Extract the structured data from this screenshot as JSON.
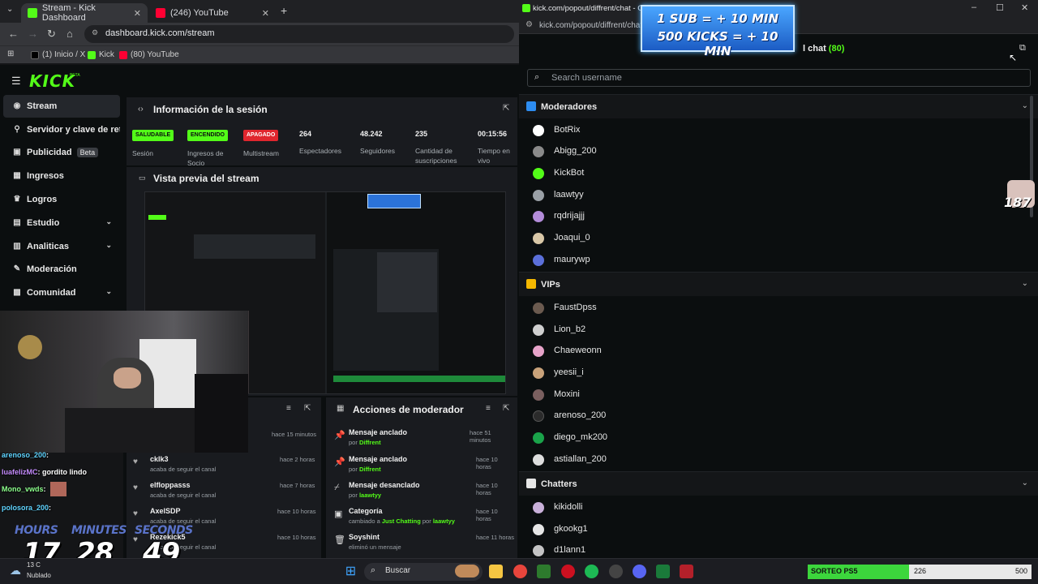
{
  "left_browser": {
    "tabs": [
      {
        "label": "Stream - Kick Dashboard",
        "icon": "kick-icon",
        "active": true
      },
      {
        "label": "(246) YouTube",
        "icon": "youtube-icon",
        "active": false
      }
    ],
    "new_tab": "+",
    "url": "dashboard.kick.com/stream",
    "bookmarks": [
      {
        "label": "(1) Inicio / X",
        "icon": "x-icon"
      },
      {
        "label": "Kick",
        "icon": "kick-icon"
      },
      {
        "label": "(80) YouTube",
        "icon": "youtube-icon"
      }
    ]
  },
  "kick": {
    "logo": "KICK",
    "logo_beta": "BETA",
    "sidebar": [
      {
        "label": "Stream",
        "icon": "stream-icon",
        "active": true,
        "chevron": false
      },
      {
        "label": "Servidor y clave de retransmisión",
        "icon": "server-icon",
        "active": false,
        "chevron": false
      },
      {
        "label": "Publicidad",
        "icon": "ads-icon",
        "active": false,
        "chevron": false,
        "badge": "Beta"
      },
      {
        "label": "Ingresos",
        "icon": "income-icon",
        "active": false,
        "chevron": false
      },
      {
        "label": "Logros",
        "icon": "trophy-icon",
        "active": false,
        "chevron": false
      },
      {
        "label": "Estudio",
        "icon": "studio-icon",
        "active": false,
        "chevron": true
      },
      {
        "label": "Analiticas",
        "icon": "analytics-icon",
        "active": false,
        "chevron": true
      },
      {
        "label": "Moderación",
        "icon": "moderation-icon",
        "active": false,
        "chevron": false
      },
      {
        "label": "Comunidad",
        "icon": "community-icon",
        "active": false,
        "chevron": true
      }
    ],
    "session": {
      "title": "Información de la sesión",
      "stats": [
        {
          "pill": "SALUDABLE",
          "pill_color": "#53fc18",
          "label": "Sesión"
        },
        {
          "pill": "ENCENDIDO",
          "pill_color": "#53fc18",
          "label": "Ingresos de Socio"
        },
        {
          "pill": "APAGADO",
          "pill_color": "#e0262e",
          "label": "Multistream"
        },
        {
          "value": "264",
          "label": "Espectadores"
        },
        {
          "value": "48.242",
          "label": "Seguidores"
        },
        {
          "value": "235",
          "label": "Cantidad de suscripciones"
        },
        {
          "value": "00:15:56",
          "label": "Tiempo en vivo"
        }
      ]
    },
    "preview_title": "Vista previa del stream",
    "mod_actions_title": "Acciones de moderador",
    "activity": [
      {
        "user": "",
        "action": "",
        "time": "hace 15 minutos"
      },
      {
        "user": "ckIk3",
        "action": "acaba de seguir el canal",
        "time": "hace 2 horas"
      },
      {
        "user": "elfloppasss",
        "action": "acaba de seguir el canal",
        "time": "hace 7 horas"
      },
      {
        "user": "AxelSDP",
        "action": "acaba de seguir el canal",
        "time": "hace 10 horas"
      },
      {
        "user": "Rezekick5",
        "action": "acaba de seguir el canal",
        "time": "hace 10 horas"
      }
    ],
    "mod_actions": [
      {
        "title": "Mensaje anclado",
        "by_prefix": "por",
        "by": "Diffrent",
        "time": "hace 51 minutos",
        "icon": "pin-icon"
      },
      {
        "title": "Mensaje anclado",
        "by_prefix": "por",
        "by": "Diffrent",
        "time": "hace 10 horas",
        "icon": "pin-icon"
      },
      {
        "title": "Mensaje desanclado",
        "by_prefix": "por",
        "by": "laawtyy",
        "time": "hace 10 horas",
        "icon": "unpin-icon"
      },
      {
        "title": "Categoría",
        "by_prefix": "cambiado a",
        "by": "Just Chatting",
        "by2_prefix": "por",
        "by2": "laawtyy",
        "time": "hace 10 horas",
        "icon": "category-icon"
      },
      {
        "title": "Soyshint",
        "by_prefix": "eliminó un mensaje",
        "by": "",
        "time": "hace 11 horas",
        "icon": "trash-icon"
      }
    ]
  },
  "overlay": {
    "chat": [
      {
        "user": "arenoso_200",
        "text": ":",
        "color": "#5fd4ff"
      },
      {
        "user": "luafelizMC",
        "text": ": gordito lindo",
        "color": "#c68cff"
      },
      {
        "user": "Mono_vwds",
        "text": ":",
        "color": "#8cff8c"
      },
      {
        "user": "polosora_200",
        "text": ":",
        "color": "#5fd4ff"
      }
    ],
    "timer": {
      "labels": [
        "HOURS",
        "MINUTES",
        "SECONDS"
      ],
      "values": [
        "17",
        "28",
        "49"
      ]
    },
    "promo": [
      "1 SUB = + 10 MIN",
      "500 KICKS = + 10 MIN"
    ],
    "kicks_badge": "187"
  },
  "chat_window": {
    "title": "kick.com/popout/diffrent/chat - Goo",
    "url": "kick.com/popout/diffrent/chat",
    "header": "l chat",
    "count": "(80)",
    "search_placeholder": "Search username",
    "sections": [
      {
        "label": "Moderadores",
        "icon_color": "#2d8cf0",
        "users": [
          {
            "name": "BotRix",
            "color": "#ffffff"
          },
          {
            "name": "Abigg_200",
            "color": "#8a8a8a"
          },
          {
            "name": "KickBot",
            "color": "#53fc18"
          },
          {
            "name": "laawtyy",
            "color": "#9aa0a6"
          },
          {
            "name": "rqdrijajjj",
            "color": "#b38cd9"
          },
          {
            "name": "Joaqui_0",
            "color": "#d9c7a7"
          },
          {
            "name": "maurywp",
            "color": "#5b6fd9"
          }
        ]
      },
      {
        "label": "VIPs",
        "icon_color": "#f5b800",
        "users": [
          {
            "name": "FaustDpss",
            "color": "#6b5a4f"
          },
          {
            "name": "Lion_b2",
            "color": "#cfcfcf"
          },
          {
            "name": "Chaeweonn",
            "color": "#e7a3c9"
          },
          {
            "name": "yeesii_i",
            "color": "#c9a27a"
          },
          {
            "name": "Moxini",
            "color": "#7a5f5f"
          },
          {
            "name": "arenoso_200",
            "color": "#2b2b2b"
          },
          {
            "name": "diego_mk200",
            "color": "#1aa34a"
          },
          {
            "name": "astiallan_200",
            "color": "#dddddd"
          }
        ]
      },
      {
        "label": "Chatters",
        "icon_color": "#e6e6e6",
        "users": [
          {
            "name": "kikidolli",
            "color": "#c9b0d9"
          },
          {
            "name": "gkookg1",
            "color": "#e6e6e6"
          },
          {
            "name": "d1lann1",
            "color": "#c4c4c4"
          }
        ]
      }
    ]
  },
  "taskbar": {
    "weather_temp": "13 C",
    "weather_label": "Nublado",
    "search": "Buscar",
    "giveaway_label": "SORTEO PS5",
    "giveaway_value": "226",
    "giveaway_goal": "500",
    "giveaway_progress": 0.452
  }
}
